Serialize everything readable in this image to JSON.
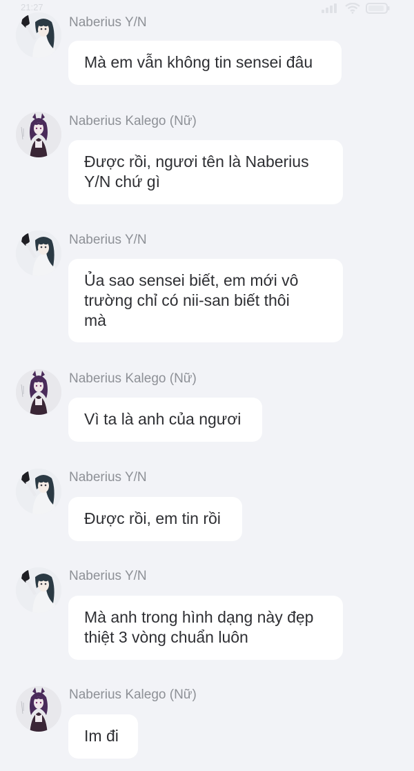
{
  "status": {
    "time": "21:27"
  },
  "messages": [
    {
      "sender": "Naberius Y/N",
      "avatar": "yn-avatar",
      "text": "Mà em vẫn không tin sensei đâu"
    },
    {
      "sender": "Naberius Kalego (Nữ)",
      "avatar": "kalego-avatar",
      "text": "Được rồi, ngươi tên là Naberius\nY/N chứ gì"
    },
    {
      "sender": "Naberius Y/N",
      "avatar": "yn-avatar",
      "text": "Ủa sao sensei biết, em mới vô\ntrường chỉ có nii-san biết thôi\nmà"
    },
    {
      "sender": "Naberius Kalego (Nữ)",
      "avatar": "kalego-avatar",
      "text": "Vì ta là anh của ngươi"
    },
    {
      "sender": "Naberius Y/N",
      "avatar": "yn-avatar",
      "text": "Được rồi, em tin rồi"
    },
    {
      "sender": "Naberius Y/N",
      "avatar": "yn-avatar",
      "text": "Mà anh trong hình dạng này đẹp\nthiệt 3 vòng chuẩn luôn"
    },
    {
      "sender": "Naberius Kalego (Nữ)",
      "avatar": "kalego-avatar",
      "text": "Im đi"
    }
  ]
}
